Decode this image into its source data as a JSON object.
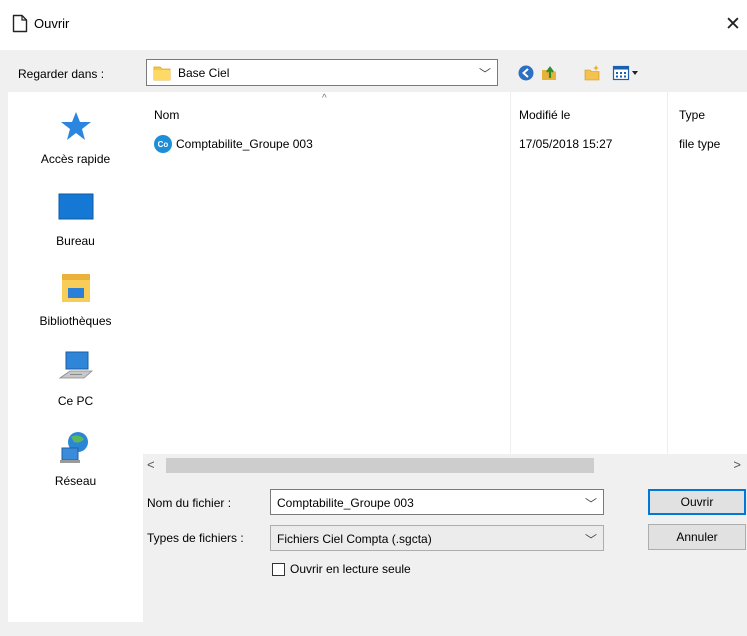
{
  "titlebar": {
    "title": "Ouvrir",
    "close_glyph": "✕"
  },
  "lookin": {
    "label": "Regarder dans :",
    "value": "Base Ciel",
    "arrow": "﹀"
  },
  "toolbar": {
    "icons": [
      "back-icon",
      "up-folder-icon",
      "new-folder-icon",
      "views-menu-icon"
    ]
  },
  "places": [
    {
      "label": "Accès rapide",
      "icon": "quick-access-star-icon"
    },
    {
      "label": "Bureau",
      "icon": "desktop-icon"
    },
    {
      "label": "Bibliothèques",
      "icon": "libraries-icon"
    },
    {
      "label": "Ce PC",
      "icon": "this-pc-icon"
    },
    {
      "label": "Réseau",
      "icon": "network-icon"
    }
  ],
  "filelist": {
    "columns": [
      "Nom",
      "Modifié le",
      "Type"
    ],
    "sort_arrow": "^",
    "rows": [
      {
        "icon_text": "Co",
        "name": "Comptabilite_Groupe 003",
        "modified": "17/05/2018 15:27",
        "type": "file type"
      }
    ],
    "scroll_left": "<",
    "scroll_right": ">"
  },
  "form": {
    "filename_label": "Nom du fichier :",
    "filename_value": "Comptabilite_Groupe 003",
    "filetype_label": "Types de fichiers :",
    "filetype_value": "Fichiers Ciel Compta (.sgcta)",
    "readonly_label": "Ouvrir en lecture seule",
    "readonly_checked": false,
    "arrow": "﹀"
  },
  "buttons": {
    "open": "Ouvrir",
    "cancel": "Annuler"
  },
  "colors": {
    "accent": "#0078d7",
    "dialog_bg": "#f0f0f0",
    "co_badge": "#1e8fd6"
  }
}
